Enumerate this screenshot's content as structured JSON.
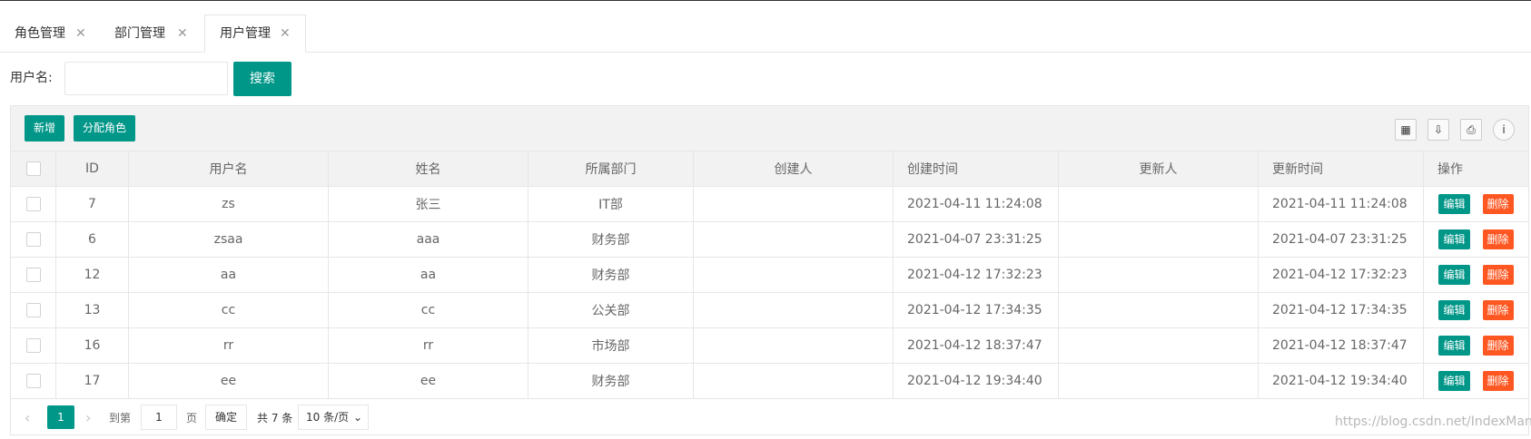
{
  "tabs": [
    {
      "label": "角色管理",
      "active": false
    },
    {
      "label": "部门管理",
      "active": false
    },
    {
      "label": "用户管理",
      "active": true
    }
  ],
  "search": {
    "label": "用户名:",
    "value": "",
    "button": "搜索"
  },
  "toolbar": {
    "add": "新增",
    "assign_role": "分配角色"
  },
  "columns": [
    "ID",
    "用户名",
    "姓名",
    "所属部门",
    "创建人",
    "创建时间",
    "更新人",
    "更新时间",
    "操作"
  ],
  "rows": [
    {
      "id": "7",
      "username": "zs",
      "name": "张三",
      "dept": "IT部",
      "creator": "",
      "created": "2021-04-11 11:24:08",
      "updater": "",
      "updated": "2021-04-11 11:24:08"
    },
    {
      "id": "6",
      "username": "zsaa",
      "name": "aaa",
      "dept": "财务部",
      "creator": "",
      "created": "2021-04-07 23:31:25",
      "updater": "",
      "updated": "2021-04-07 23:31:25"
    },
    {
      "id": "12",
      "username": "aa",
      "name": "aa",
      "dept": "财务部",
      "creator": "",
      "created": "2021-04-12 17:32:23",
      "updater": "",
      "updated": "2021-04-12 17:32:23"
    },
    {
      "id": "13",
      "username": "cc",
      "name": "cc",
      "dept": "公关部",
      "creator": "",
      "created": "2021-04-12 17:34:35",
      "updater": "",
      "updated": "2021-04-12 17:34:35"
    },
    {
      "id": "16",
      "username": "rr",
      "name": "rr",
      "dept": "市场部",
      "creator": "",
      "created": "2021-04-12 18:37:47",
      "updater": "",
      "updated": "2021-04-12 18:37:47"
    },
    {
      "id": "17",
      "username": "ee",
      "name": "ee",
      "dept": "财务部",
      "creator": "",
      "created": "2021-04-12 19:34:40",
      "updater": "",
      "updated": "2021-04-12 19:34:40"
    }
  ],
  "row_actions": {
    "edit": "编辑",
    "delete": "删除"
  },
  "pager": {
    "current": "1",
    "goto_label": "到第",
    "page_value": "1",
    "page_suffix": "页",
    "confirm": "确定",
    "total": "共 7 条",
    "page_size": "10 条/页"
  },
  "watermark": "https://blog.csdn.net/IndexMan",
  "colors": {
    "primary": "#009688",
    "danger": "#FF5722"
  }
}
